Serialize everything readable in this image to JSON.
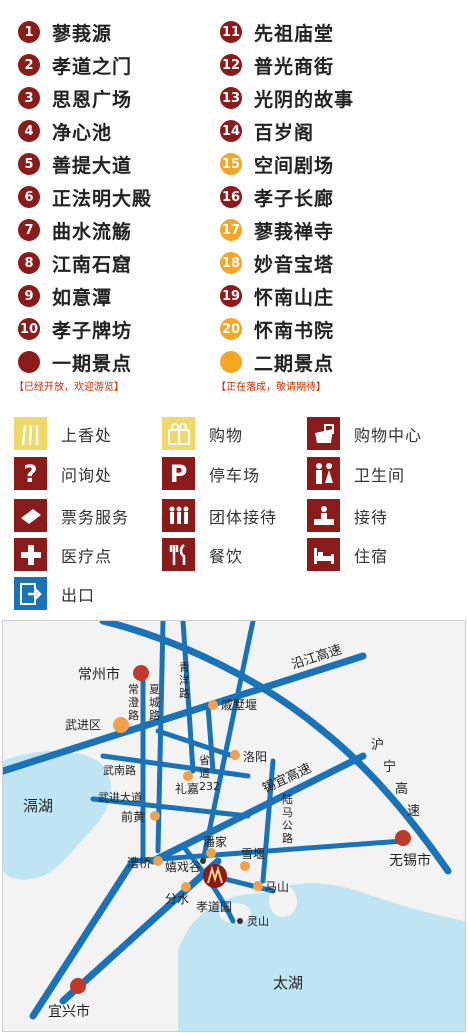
{
  "legend": {
    "left": [
      {
        "num": "1",
        "name": "蓼莪源",
        "phase": "r"
      },
      {
        "num": "2",
        "name": "孝道之门",
        "phase": "r"
      },
      {
        "num": "3",
        "name": "思恩广场",
        "phase": "r"
      },
      {
        "num": "4",
        "name": "净心池",
        "phase": "r"
      },
      {
        "num": "5",
        "name": "善提大道",
        "phase": "r"
      },
      {
        "num": "6",
        "name": "正法明大殿",
        "phase": "r"
      },
      {
        "num": "7",
        "name": "曲水流觞",
        "phase": "r"
      },
      {
        "num": "8",
        "name": "江南石窟",
        "phase": "r"
      },
      {
        "num": "9",
        "name": "如意潭",
        "phase": "r"
      },
      {
        "num": "10",
        "name": "孝子牌坊",
        "phase": "r"
      }
    ],
    "right": [
      {
        "num": "11",
        "name": "先祖庙堂",
        "phase": "r"
      },
      {
        "num": "12",
        "name": "普光商街",
        "phase": "r"
      },
      {
        "num": "13",
        "name": "光阴的故事",
        "phase": "r"
      },
      {
        "num": "14",
        "name": "百岁阁",
        "phase": "r"
      },
      {
        "num": "15",
        "name": "空间剧场",
        "phase": "o"
      },
      {
        "num": "16",
        "name": "孝子长廊",
        "phase": "r"
      },
      {
        "num": "17",
        "name": "蓼莪禅寺",
        "phase": "o"
      },
      {
        "num": "18",
        "name": "妙音宝塔",
        "phase": "o"
      },
      {
        "num": "19",
        "name": "怀南山庄",
        "phase": "r"
      },
      {
        "num": "20",
        "name": "怀南书院",
        "phase": "o"
      }
    ],
    "phase1": {
      "label": "一期景点",
      "note": "【已经开放，欢迎游览】",
      "color": "#8b1a1a"
    },
    "phase2": {
      "label": "二期景点",
      "note": "【正在落成，敬请期待】",
      "color": "#f5a623"
    }
  },
  "facilities": [
    {
      "icon": "incense-icon",
      "label": "上香处",
      "style": "gold"
    },
    {
      "icon": "gift-icon",
      "label": "购物",
      "style": "gold"
    },
    {
      "icon": "shopping-center-icon",
      "label": "购物中心",
      "style": "dark"
    },
    {
      "icon": "question-icon",
      "label": "问询处",
      "style": "dark"
    },
    {
      "icon": "parking-icon",
      "label": "停车场",
      "style": "dark"
    },
    {
      "icon": "restroom-icon",
      "label": "卫生间",
      "style": "dark"
    },
    {
      "icon": "ticket-icon",
      "label": "票务服务",
      "style": "dark"
    },
    {
      "icon": "group-reception-icon",
      "label": "团体接待",
      "style": "dark"
    },
    {
      "icon": "reception-icon",
      "label": "接待",
      "style": "dark"
    },
    {
      "icon": "first-aid-icon",
      "label": "医疗点",
      "style": "dark"
    },
    {
      "icon": "dining-icon",
      "label": "餐饮",
      "style": "dark"
    },
    {
      "icon": "bed-icon",
      "label": "住宿",
      "style": "dark"
    },
    {
      "icon": "exit-icon",
      "label": "出口",
      "style": "blue"
    }
  ],
  "map": {
    "cities": [
      "常州市",
      "无锡市",
      "宜兴市"
    ],
    "lakes": [
      "滆湖",
      "太湖"
    ],
    "highways": [
      "沿江高速",
      "沪宁高速",
      "锡宜高速"
    ],
    "roads": [
      "常澄路",
      "夏城路",
      "青洋路",
      "武南路",
      "武进大道",
      "省道232",
      "陆马公路"
    ],
    "places": [
      "武进区",
      "戚墅堰",
      "洛阳",
      "礼嘉",
      "前黄",
      "潘家",
      "雪堰",
      "漕桥",
      "嬉戏谷",
      "分水",
      "孝道园",
      "马山",
      "灵山"
    ]
  }
}
